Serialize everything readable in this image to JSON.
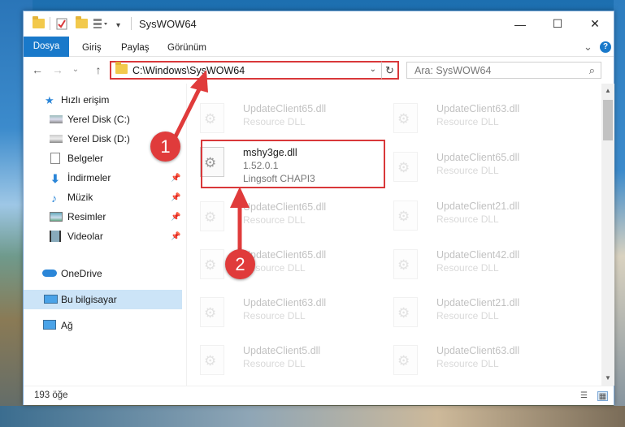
{
  "window": {
    "title": "SysWOW64",
    "minimize": "—",
    "maximize": "☐",
    "close": "✕"
  },
  "ribbon": {
    "tabs": [
      "Dosya",
      "Giriş",
      "Paylaş",
      "Görünüm"
    ],
    "collapse": "⌄",
    "help": "?"
  },
  "navigation": {
    "back": "←",
    "forward": "→",
    "recent": "⌄",
    "up": "↑",
    "address": "C:\\Windows\\SysWOW64",
    "address_dropdown": "⌄",
    "refresh": "↻",
    "search_placeholder": "Ara: SysWOW64",
    "search_icon": "⌕"
  },
  "sidebar": {
    "items": [
      {
        "label": "Hızlı erişim",
        "icon": "star-icon",
        "pinned": false
      },
      {
        "label": "Yerel Disk (C:)",
        "icon": "drive-icon",
        "pinned": false
      },
      {
        "label": "Yerel Disk (D:)",
        "icon": "drive-icon",
        "pinned": false
      },
      {
        "label": "Belgeler",
        "icon": "documents-icon",
        "pinned": false
      },
      {
        "label": "İndirmeler",
        "icon": "download-icon",
        "pinned": true
      },
      {
        "label": "Müzik",
        "icon": "music-icon",
        "pinned": true
      },
      {
        "label": "Resimler",
        "icon": "pictures-icon",
        "pinned": true
      },
      {
        "label": "Videolar",
        "icon": "video-icon",
        "pinned": true
      },
      {
        "label": "OneDrive",
        "icon": "cloud-icon",
        "pinned": false
      },
      {
        "label": "Bu bilgisayar",
        "icon": "computer-icon",
        "pinned": false,
        "selected": true
      },
      {
        "label": "Ağ",
        "icon": "network-icon",
        "pinned": false
      }
    ],
    "pin_glyph": "📌"
  },
  "files": {
    "highlighted": {
      "name": "mshy3ge.dll",
      "version": "1.52.0.1",
      "company": "Lingsoft CHAPI3"
    },
    "left_column": [
      {
        "name": "UpdateClient65.dll",
        "type": "Resource DLL"
      },
      {
        "name": "UpdateClient65.dll",
        "type": "Resource DLL"
      },
      {
        "name": "UpdateClient65.dll",
        "type": "Resource DLL"
      },
      {
        "name": "UpdateClient63.dll",
        "type": "Resource DLL"
      },
      {
        "name": "UpdateClient5.dll",
        "type": "Resource DLL"
      }
    ],
    "right_column": [
      {
        "name": "UpdateClient63.dll",
        "type": "Resource DLL"
      },
      {
        "name": "UpdateClient65.dll",
        "type": "Resource DLL"
      },
      {
        "name": "UpdateClient21.dll",
        "type": "Resource DLL"
      },
      {
        "name": "UpdateClient42.dll",
        "type": "Resource DLL"
      },
      {
        "name": "UpdateClient21.dll",
        "type": "Resource DLL"
      },
      {
        "name": "UpdateClient63.dll",
        "type": "Resource DLL"
      }
    ]
  },
  "status": {
    "count": "193 öğe"
  },
  "callouts": {
    "one": "1",
    "two": "2"
  },
  "colors": {
    "accent": "#1979ca",
    "highlight_border": "#d9383a",
    "callout": "#e03b3b",
    "selected": "#cce4f7"
  }
}
